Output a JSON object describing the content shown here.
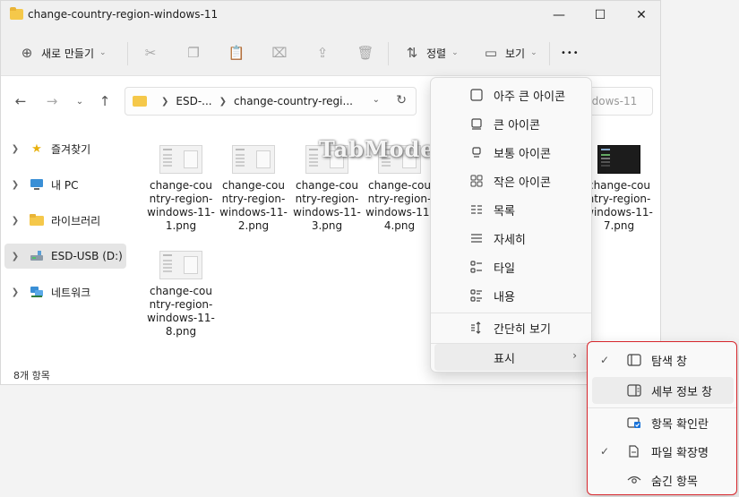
{
  "window": {
    "title": "change-country-region-windows-11"
  },
  "toolbar": {
    "new_label": "새로 만들기",
    "sort_label": "정렬",
    "view_label": "보기",
    "more_label": "•••"
  },
  "navbar": {
    "breadcrumb": [
      "ESD-...",
      "change-country-regi..."
    ],
    "search_fragment": "ndows-11"
  },
  "sidebar": {
    "items": [
      {
        "label": "즐겨찾기",
        "icon": "star-icon"
      },
      {
        "label": "내 PC",
        "icon": "pc-icon"
      },
      {
        "label": "라이브러리",
        "icon": "library-folder-icon"
      },
      {
        "label": "ESD-USB (D:)",
        "icon": "usb-drive-icon",
        "selected": true
      },
      {
        "label": "네트워크",
        "icon": "network-icon"
      }
    ]
  },
  "files": [
    {
      "name": "change-country-region-windows-11-1.png"
    },
    {
      "name": "change-country-region-windows-11-2.png"
    },
    {
      "name": "change-country-region-windows-11-3.png"
    },
    {
      "name": "change-country-region-windows-11-4.png"
    },
    {
      "name": "change-country-region-windows-11-7.png"
    },
    {
      "name": "change-country-region-windows-11-8.png"
    }
  ],
  "status": {
    "item_count": "8개 항목"
  },
  "watermark": "TabMode.com",
  "view_menu": {
    "items": [
      {
        "label": "아주 큰 아이콘",
        "icon": "extra-large-icons-icon"
      },
      {
        "label": "큰 아이콘",
        "icon": "large-icons-icon"
      },
      {
        "label": "보통 아이콘",
        "icon": "medium-icons-icon"
      },
      {
        "label": "작은 아이콘",
        "icon": "small-icons-icon"
      },
      {
        "label": "목록",
        "icon": "list-icon"
      },
      {
        "label": "자세히",
        "icon": "details-icon"
      },
      {
        "label": "타일",
        "icon": "tiles-icon"
      },
      {
        "label": "내용",
        "icon": "content-icon"
      }
    ],
    "compact_label": "간단히 보기",
    "show_label": "표시"
  },
  "show_submenu": {
    "items": [
      {
        "label": "탐색 창",
        "checked": true,
        "icon": "navigation-pane-icon"
      },
      {
        "label": "세부 정보 창",
        "checked": false,
        "icon": "details-pane-icon"
      },
      {
        "label": "항목 확인란",
        "checked": false,
        "icon": "item-checkbox-icon"
      },
      {
        "label": "파일 확장명",
        "checked": true,
        "icon": "file-extension-icon"
      },
      {
        "label": "숨긴 항목",
        "checked": false,
        "icon": "hidden-items-icon"
      }
    ]
  },
  "colors": {
    "highlight_border": "#d7262c",
    "folder": "#f5c84a"
  }
}
